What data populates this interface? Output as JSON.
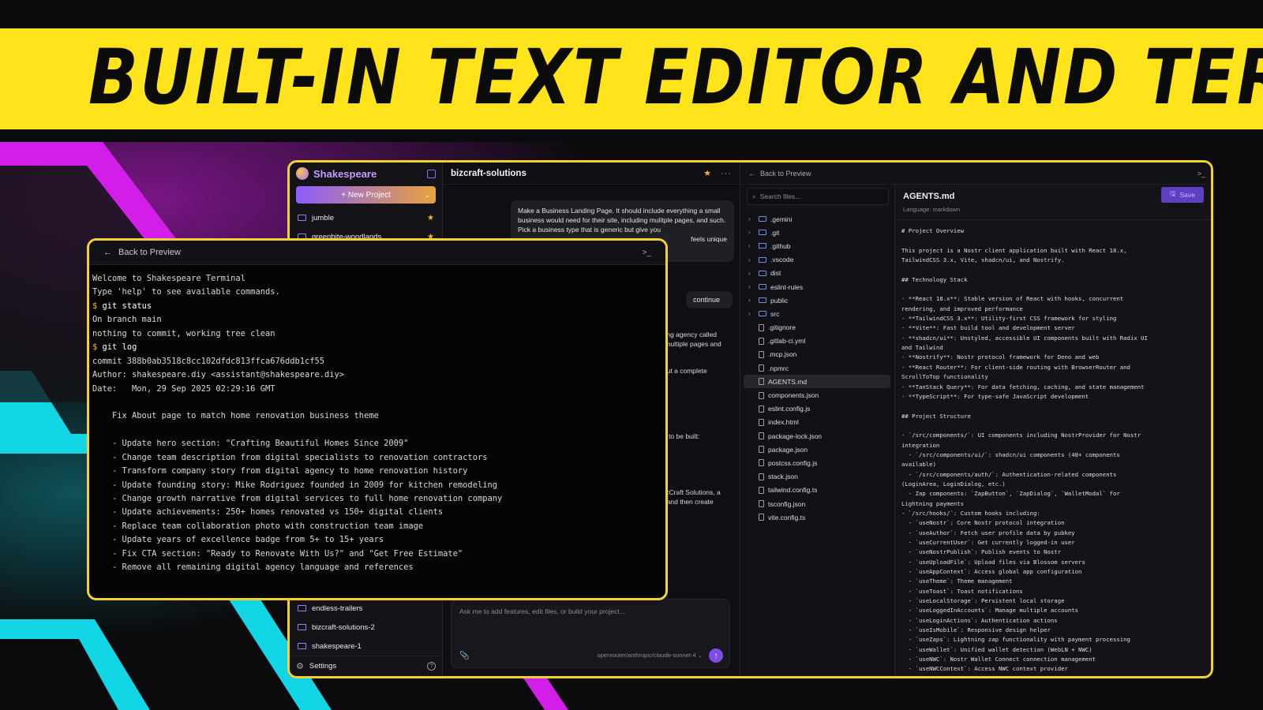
{
  "banner": {
    "title": "BUILT-IN TEXT EDITOR AND TERMINAL"
  },
  "colors": {
    "banner": "#ffe41c",
    "frame": "#f5d130",
    "accent": "#8c5cff",
    "star": "#f4b41a",
    "magenta": "#d21ee8",
    "cyan": "#12d5e6"
  },
  "sidebar": {
    "app_title": "Shakespeare",
    "new_project": "New Project",
    "projects": [
      {
        "name": "jumble",
        "starred": true
      },
      {
        "name": "greenbite-woodlands",
        "starred": true
      }
    ],
    "bottom_projects": [
      {
        "name": "endless-trailers"
      },
      {
        "name": "bizcraft-solutions-2"
      },
      {
        "name": "shakespeare-1"
      }
    ],
    "settings": "Settings"
  },
  "chat": {
    "title": "bizcraft-solutions",
    "message": "Make a Business Landing Page. It should include everything a small business would need for their site, including mulitple pages, and such. Pick a business type that is generic but give you",
    "message_tail": "feels unique",
    "continue_label": "continue",
    "fragments": [
      "keting agency called",
      "se multiple pages and",
      "ld out a complete",
      "eds to be built:",
      "f BizCraft Solutions, a",
      "nts and then create"
    ],
    "input_placeholder": "Ask me to add features, edit files, or build your project...",
    "model": "openrouter/anthropic/claude-sonnet-4"
  },
  "files": {
    "back_label": "Back to Preview",
    "search_placeholder": "Search files...",
    "tree": [
      {
        "name": ".gemini",
        "type": "folder"
      },
      {
        "name": ".git",
        "type": "folder"
      },
      {
        "name": ".github",
        "type": "folder"
      },
      {
        "name": ".vscode",
        "type": "folder"
      },
      {
        "name": "dist",
        "type": "folder"
      },
      {
        "name": "eslint-rules",
        "type": "folder"
      },
      {
        "name": "public",
        "type": "folder"
      },
      {
        "name": "src",
        "type": "folder"
      },
      {
        "name": ".gitignore",
        "type": "file"
      },
      {
        "name": ".gitlab-ci.yml",
        "type": "file"
      },
      {
        "name": ".mcp.json",
        "type": "file"
      },
      {
        "name": ".npmrc",
        "type": "file"
      },
      {
        "name": "AGENTS.md",
        "type": "file",
        "selected": true
      },
      {
        "name": "components.json",
        "type": "file"
      },
      {
        "name": "eslint.config.js",
        "type": "file"
      },
      {
        "name": "index.html",
        "type": "file"
      },
      {
        "name": "package-lock.json",
        "type": "file"
      },
      {
        "name": "package.json",
        "type": "file"
      },
      {
        "name": "postcss.config.js",
        "type": "file"
      },
      {
        "name": "stack.json",
        "type": "file"
      },
      {
        "name": "tailwind.config.ts",
        "type": "file"
      },
      {
        "name": "tsconfig.json",
        "type": "file"
      },
      {
        "name": "vite.config.ts",
        "type": "file"
      }
    ]
  },
  "editor": {
    "filename": "AGENTS.md",
    "language": "Language: markdown",
    "save_label": "Save",
    "lines": [
      "# Project Overview",
      "",
      "This project is a Nostr client application built with React 18.x,",
      "TailwindCSS 3.x, Vite, shadcn/ui, and Nostrify.",
      "",
      "## Technology Stack",
      "",
      "- **React 18.x**: Stable version of React with hooks, concurrent",
      "rendering, and improved performance",
      "- **TailwindCSS 3.x**: Utility-first CSS framework for styling",
      "- **Vite**: Fast build tool and development server",
      "- **shadcn/ui**: Unstyled, accessible UI components built with Radix UI",
      "and Tailwind",
      "- **Nostrify**: Nostr protocol framework for Deno and web",
      "- **React Router**: For client-side routing with BrowserRouter and",
      "ScrollToTop functionality",
      "- **TanStack Query**: For data fetching, caching, and state management",
      "- **TypeScript**: For type-safe JavaScript development",
      "",
      "## Project Structure",
      "",
      "- `/src/components/`: UI components including NostrProvider for Nostr",
      "integration",
      "  - `/src/components/ui/`: shadcn/ui components (48+ components",
      "available)",
      "  - `/src/components/auth/`: Authentication-related components",
      "(LoginArea, LoginDialog, etc.)",
      "  - Zap components: `ZapButton`, `ZapDialog`, `WalletModal` for",
      "Lightning payments",
      "- `/src/hooks/`: Custom hooks including:",
      "  - `useNostr`: Core Nostr protocol integration",
      "  - `useAuthor`: Fetch user profile data by pubkey",
      "  - `useCurrentUser`: Get currently logged-in user",
      "  - `useNostrPublish`: Publish events to Nostr",
      "  - `useUploadFile`: Upload files via Blossom servers",
      "  - `useAppContext`: Access global app configuration",
      "  - `useTheme`: Theme management",
      "  - `useToast`: Toast notifications",
      "  - `useLocalStorage`: Persistent local storage",
      "  - `useLoggedInAccounts`: Manage multiple accounts",
      "  - `useLoginActions`: Authentication actions",
      "  - `useIsMobile`: Responsive design helper",
      "  - `useZaps`: Lightning zap functionality with payment processing",
      "  - `useWallet`: Unified wallet detection (WebLN + NWC)",
      "  - `useNWC`: Nostr Wallet Connect connection management",
      "  - `useNWCContext`: Access NWC context provider"
    ]
  },
  "terminal": {
    "back_label": "Back to Preview",
    "lines": [
      {
        "kind": "out",
        "text": "Welcome to Shakespeare Terminal"
      },
      {
        "kind": "out",
        "text": "Type 'help' to see available commands."
      },
      {
        "kind": "cmd",
        "prompt": "$",
        "text": "git status"
      },
      {
        "kind": "out",
        "text": "On branch main"
      },
      {
        "kind": "out",
        "text": "nothing to commit, working tree clean"
      },
      {
        "kind": "cmd",
        "prompt": "$",
        "text": "git log"
      },
      {
        "kind": "out",
        "text": "commit 388b0ab3518c8cc102dfdc813ffca676ddb1cf55"
      },
      {
        "kind": "out",
        "text": "Author: shakespeare.diy <assistant@shakespeare.diy>"
      },
      {
        "kind": "out",
        "text": "Date:   Mon, 29 Sep 2025 02:29:16 GMT"
      },
      {
        "kind": "out",
        "text": ""
      },
      {
        "kind": "out",
        "text": "    Fix About page to match home renovation business theme"
      },
      {
        "kind": "out",
        "text": ""
      },
      {
        "kind": "out",
        "text": "    - Update hero section: \"Crafting Beautiful Homes Since 2009\""
      },
      {
        "kind": "out",
        "text": "    - Change team description from digital specialists to renovation contractors"
      },
      {
        "kind": "out",
        "text": "    - Transform company story from digital agency to home renovation history"
      },
      {
        "kind": "out",
        "text": "    - Update founding story: Mike Rodriguez founded in 2009 for kitchen remodeling"
      },
      {
        "kind": "out",
        "text": "    - Change growth narrative from digital services to full home renovation company"
      },
      {
        "kind": "out",
        "text": "    - Update achievements: 250+ homes renovated vs 150+ digital clients"
      },
      {
        "kind": "out",
        "text": "    - Replace team collaboration photo with construction team image"
      },
      {
        "kind": "out",
        "text": "    - Update years of excellence badge from 5+ to 15+ years"
      },
      {
        "kind": "out",
        "text": "    - Fix CTA section: \"Ready to Renovate With Us?\" and \"Get Free Estimate\""
      },
      {
        "kind": "out",
        "text": "    - Remove all remaining digital agency language and references"
      }
    ]
  }
}
